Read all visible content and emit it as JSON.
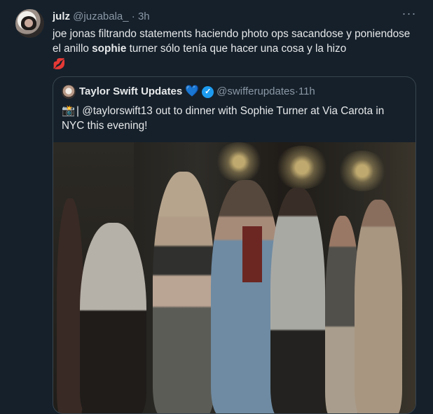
{
  "tweet": {
    "author_name": "julz",
    "handle": "@juzabala_",
    "separator": " · ",
    "time": "3h",
    "more_icon": "more-horizontal-icon",
    "text_before": "joe jonas filtrando statements haciendo photo ops sacandose y poniendose el anillo ",
    "text_bold": "sophie",
    "text_after": " turner sólo tenía que hacer una cosa y la hizo",
    "emoji": "💋"
  },
  "quote": {
    "author_name": "Taylor Swift Updates",
    "heart": "💙",
    "verified_icon": "verified-badge-icon",
    "handle": "@swifferupdates",
    "separator": " · ",
    "time": "11h",
    "text_emoji": "📸",
    "text": "| @taylorswift13 out to dinner with Sophie Turner at Via Carota in NYC this evening!"
  },
  "colors": {
    "background": "#15202b",
    "text": "#e7e9ea",
    "muted": "#8b98a5",
    "border": "#38444d",
    "verified": "#1d9bf0"
  }
}
